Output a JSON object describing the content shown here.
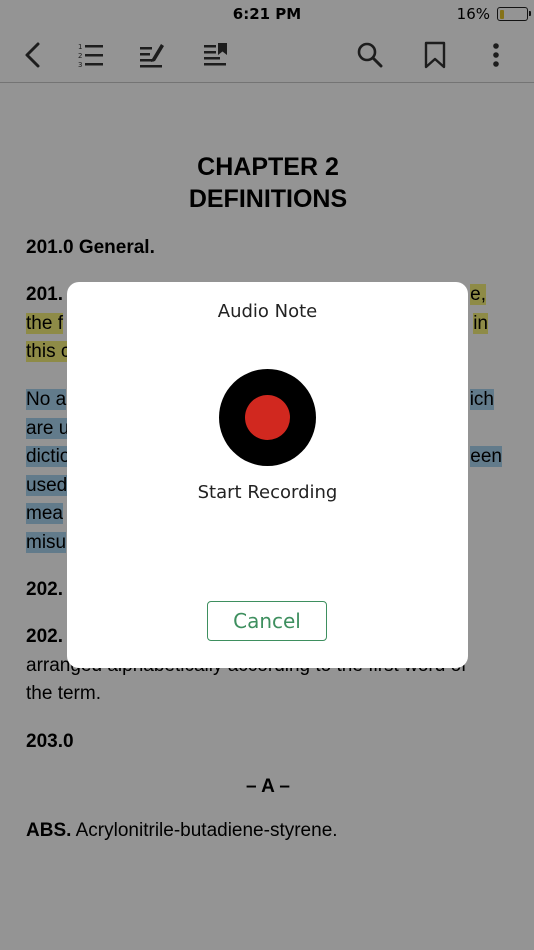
{
  "status_bar": {
    "time": "6:21 PM",
    "battery_percent": "16%",
    "battery_level": 0.16
  },
  "toolbar": {
    "back_icon": "chevron-left-icon",
    "contents_icon": "numbered-list-icon",
    "notes_icon": "edit-list-icon",
    "bookmarks_list_icon": "bookmark-list-icon",
    "search_icon": "search-icon",
    "bookmark_icon": "bookmark-icon",
    "more_icon": "more-vertical-icon"
  },
  "document": {
    "chapter_line1": "CHAPTER 2",
    "chapter_line2": "DEFINITIONS",
    "section_general": "201.0 General.",
    "para_201_1_head": "201.",
    "para_201_1_line1_end": "e,",
    "para_201_1_line2_start": "the f",
    "para_201_1_line2_end": "in",
    "para_201_1_line3_start": "this c",
    "para_blue_l1_start": "No a",
    "para_blue_l1_end": "ich",
    "para_blue_l2_start": "are u",
    "para_blue_l3_start": "dictio",
    "para_blue_l3_end": "een",
    "para_blue_l4_start": "used",
    "para_blue_l5_start": "mea",
    "para_blue_l6_start": "misu",
    "section_202_a": "202.",
    "section_202_b": "202.",
    "para_202_l2": "arranged alphabetically according to the first word of",
    "para_202_l3": "the term.",
    "section_203": "203.0",
    "letter_heading": "– A –",
    "abs_term": "ABS.",
    "abs_def": " Acrylonitrile-butadiene-styrene."
  },
  "dialog": {
    "title": "Audio Note",
    "record_label": "Start Recording",
    "cancel_label": "Cancel",
    "record_color": "#d1281f",
    "accent_color": "#3e8f5f"
  }
}
